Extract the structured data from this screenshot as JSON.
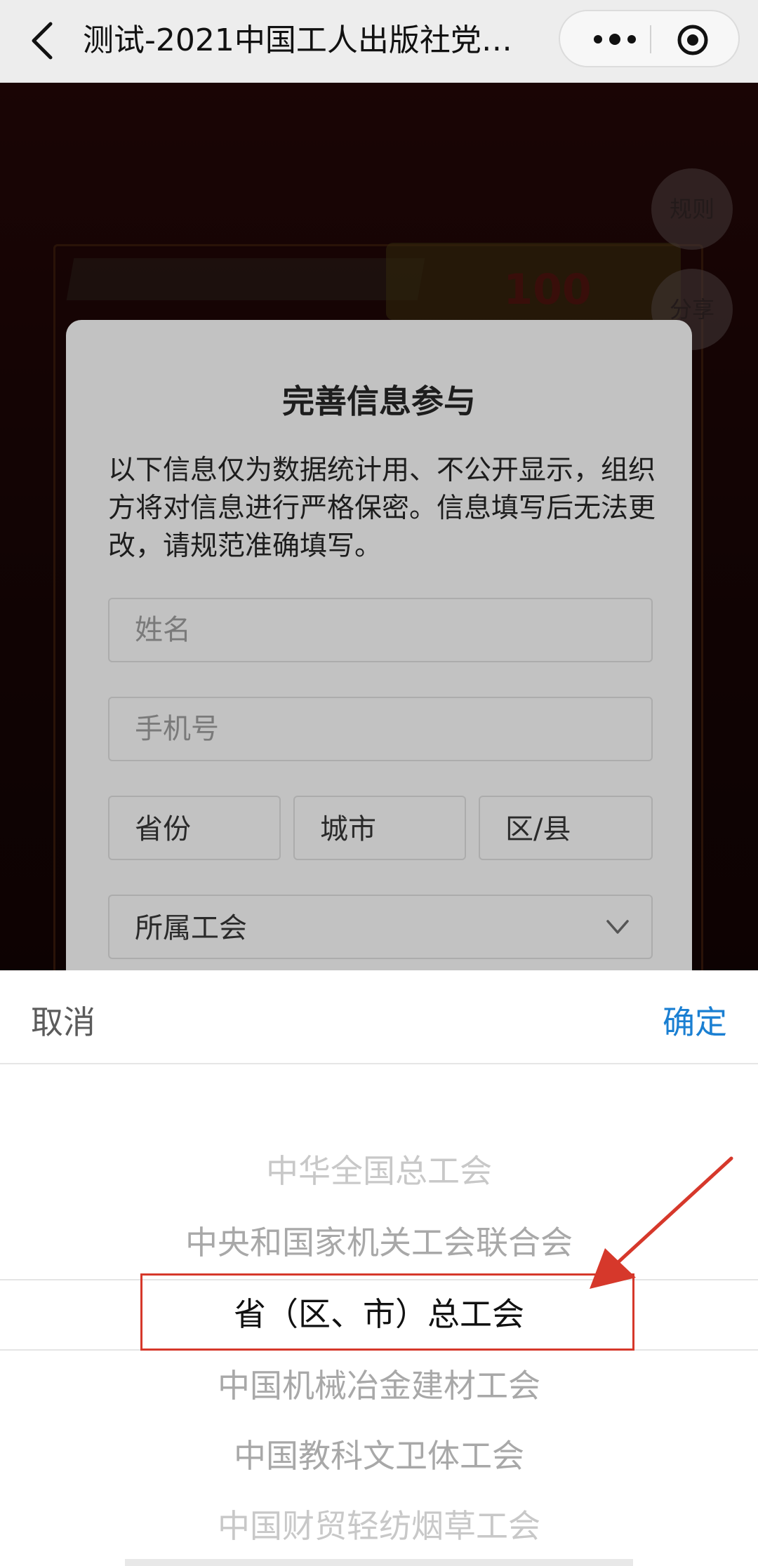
{
  "nav": {
    "title": "测试-2021中国工人出版社党…",
    "icons": {
      "back": "chevron-left-icon",
      "more": "more-dots-icon",
      "close": "target-icon"
    }
  },
  "background": {
    "badge": "100",
    "fab_rules": "规则",
    "fab_share": "分享"
  },
  "modal": {
    "title": "完善信息参与",
    "description": "以下信息仅为数据统计用、不公开显示，组织方将对信息进行严格保密。信息填写后无法更改，请规范准确填写。",
    "name_placeholder": "姓名",
    "phone_placeholder": "手机号",
    "province": "省份",
    "city": "城市",
    "district": "区/县",
    "union": "所属工会"
  },
  "picker": {
    "cancel": "取消",
    "confirm": "确定",
    "options": [
      "中华全国总工会",
      "中央和国家机关工会联合会",
      "省（区、市）总工会",
      "中国机械冶金建材工会",
      "中国教科文卫体工会",
      "中国财贸轻纺烟草工会"
    ],
    "selected_index": 2
  },
  "colors": {
    "accent_blue": "#1a7fd2",
    "highlight_red": "#d6382b",
    "page_bg_red": "#3a0d0d"
  }
}
